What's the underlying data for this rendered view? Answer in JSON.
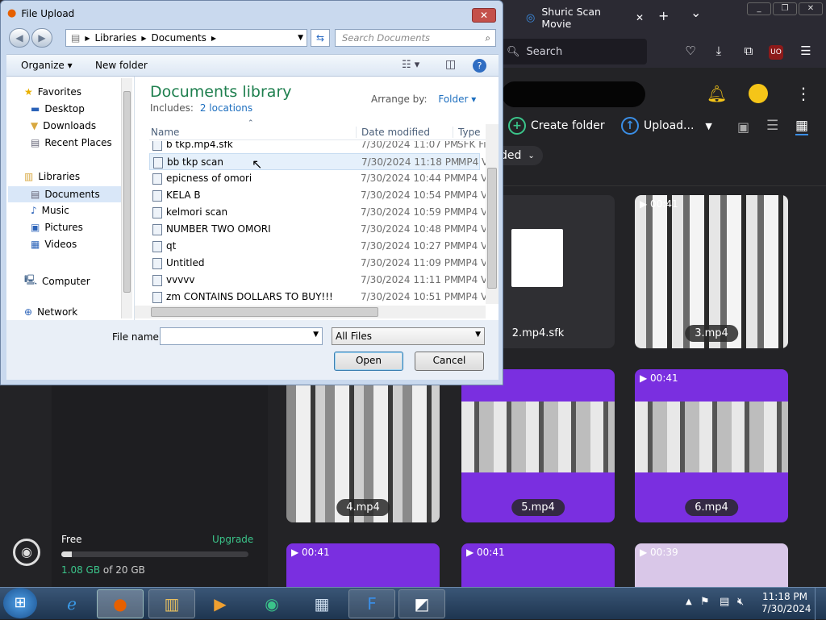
{
  "browser": {
    "tab_title": "Shuric Scan Movie",
    "search_placeholder": "Search",
    "new_tab": "+",
    "tab_list": "⌄",
    "close_tab": "✕"
  },
  "site": {
    "create_folder": "Create folder",
    "upload": "Upload...",
    "filter_label": "ded",
    "storage": {
      "plan": "Free",
      "upgrade": "Upgrade",
      "used": "1.08 GB",
      "total_text": "of 20 GB",
      "used_fraction": 0.054
    },
    "tiles": [
      {
        "name": "2.mp4.sfk",
        "duration": ""
      },
      {
        "name": "3.mp4",
        "duration": "00:41"
      },
      {
        "name": "4.mp4",
        "duration": ""
      },
      {
        "name": "5.mp4",
        "duration": ""
      },
      {
        "name": "6.mp4",
        "duration": "00:41"
      },
      {
        "name": "",
        "duration": "00:41"
      },
      {
        "name": "",
        "duration": "00:41"
      },
      {
        "name": "",
        "duration": "00:39"
      }
    ]
  },
  "dialog": {
    "title": "File Upload",
    "breadcrumb": [
      "Libraries",
      "Documents"
    ],
    "search_placeholder": "Search Documents",
    "organize": "Organize",
    "new_folder": "New folder",
    "library_title": "Documents library",
    "includes_label": "Includes:",
    "includes_link": "2 locations",
    "arrange_by_label": "Arrange by:",
    "arrange_by_value": "Folder",
    "columns": {
      "name": "Name",
      "date": "Date modified",
      "type": "Type"
    },
    "nav": {
      "favorites": "Favorites",
      "desktop": "Desktop",
      "downloads": "Downloads",
      "recent": "Recent Places",
      "libraries": "Libraries",
      "documents": "Documents",
      "music": "Music",
      "pictures": "Pictures",
      "videos": "Videos",
      "computer": "Computer",
      "network": "Network"
    },
    "files": [
      {
        "name": "b tkp.mp4.sfk",
        "date": "7/30/2024 11:07 PM",
        "type": "SFK Fil"
      },
      {
        "name": "bb tkp scan",
        "date": "7/30/2024 11:18 PM",
        "type": "MP4 V"
      },
      {
        "name": "epicness of omori",
        "date": "7/30/2024 10:44 PM",
        "type": "MP4 V"
      },
      {
        "name": "KELA B",
        "date": "7/30/2024 10:54 PM",
        "type": "MP4 V"
      },
      {
        "name": "kelmori scan",
        "date": "7/30/2024 10:59 PM",
        "type": "MP4 V"
      },
      {
        "name": "NUMBER TWO OMORI",
        "date": "7/30/2024 10:48 PM",
        "type": "MP4 V"
      },
      {
        "name": "qt",
        "date": "7/30/2024 10:27 PM",
        "type": "MP4 V"
      },
      {
        "name": "Untitled",
        "date": "7/30/2024 11:09 PM",
        "type": "MP4 V"
      },
      {
        "name": "vvvvv",
        "date": "7/30/2024 11:11 PM",
        "type": "MP4 V"
      },
      {
        "name": "zm CONTAINS DOLLARS TO BUY!!!",
        "date": "7/30/2024 10:51 PM",
        "type": "MP4 V"
      }
    ],
    "file_name_label": "File name:",
    "file_name_value": "",
    "file_type": "All Files",
    "open": "Open",
    "cancel": "Cancel"
  },
  "taskbar": {
    "time": "11:18 PM",
    "date": "7/30/2024"
  },
  "colors": {
    "accent_purple": "#7a2fe0",
    "link_blue": "#1e6fbf",
    "upgrade_green": "#3bc48a",
    "title_green": "#1e7f4e"
  }
}
